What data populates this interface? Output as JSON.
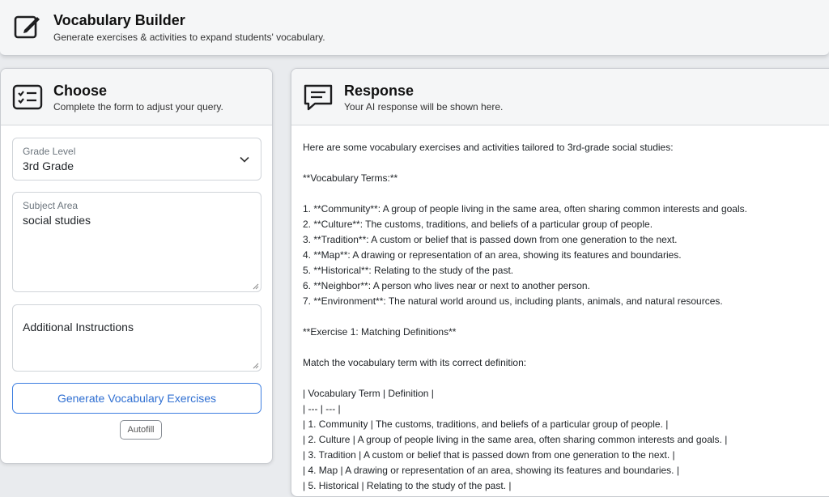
{
  "header": {
    "title": "Vocabulary Builder",
    "subtitle": "Generate exercises & activities to expand students' vocabulary."
  },
  "choose": {
    "title": "Choose",
    "subtitle": "Complete the form to adjust your query.",
    "grade": {
      "label": "Grade Level",
      "value": "3rd Grade"
    },
    "subject": {
      "label": "Subject Area",
      "value": "social studies"
    },
    "additional": {
      "placeholder": "Additional Instructions"
    },
    "generate_label": "Generate Vocabulary Exercises",
    "autofill_label": "Autofill"
  },
  "response": {
    "title": "Response",
    "subtitle": "Your AI response will be shown here.",
    "lines": [
      "Here are some vocabulary exercises and activities tailored to 3rd-grade social studies:",
      "",
      "**Vocabulary Terms:**",
      "",
      "1. **Community**: A group of people living in the same area, often sharing common interests and goals.",
      "2. **Culture**: The customs, traditions, and beliefs of a particular group of people.",
      "3. **Tradition**: A custom or belief that is passed down from one generation to the next.",
      "4. **Map**: A drawing or representation of an area, showing its features and boundaries.",
      "5. **Historical**: Relating to the study of the past.",
      "6. **Neighbor**: A person who lives near or next to another person.",
      "7. **Environment**: The natural world around us, including plants, animals, and natural resources.",
      "",
      "**Exercise 1: Matching Definitions**",
      "",
      "Match the vocabulary term with its correct definition:",
      "",
      "| Vocabulary Term | Definition |",
      "| --- | --- |",
      "| 1. Community | The customs, traditions, and beliefs of a particular group of people. |",
      "| 2. Culture | A group of people living in the same area, often sharing common interests and goals. |",
      "| 3. Tradition | A custom or belief that is passed down from one generation to the next. |",
      "| 4. Map | A drawing or representation of an area, showing its features and boundaries. |",
      "| 5. Historical | Relating to the study of the past. |"
    ]
  }
}
